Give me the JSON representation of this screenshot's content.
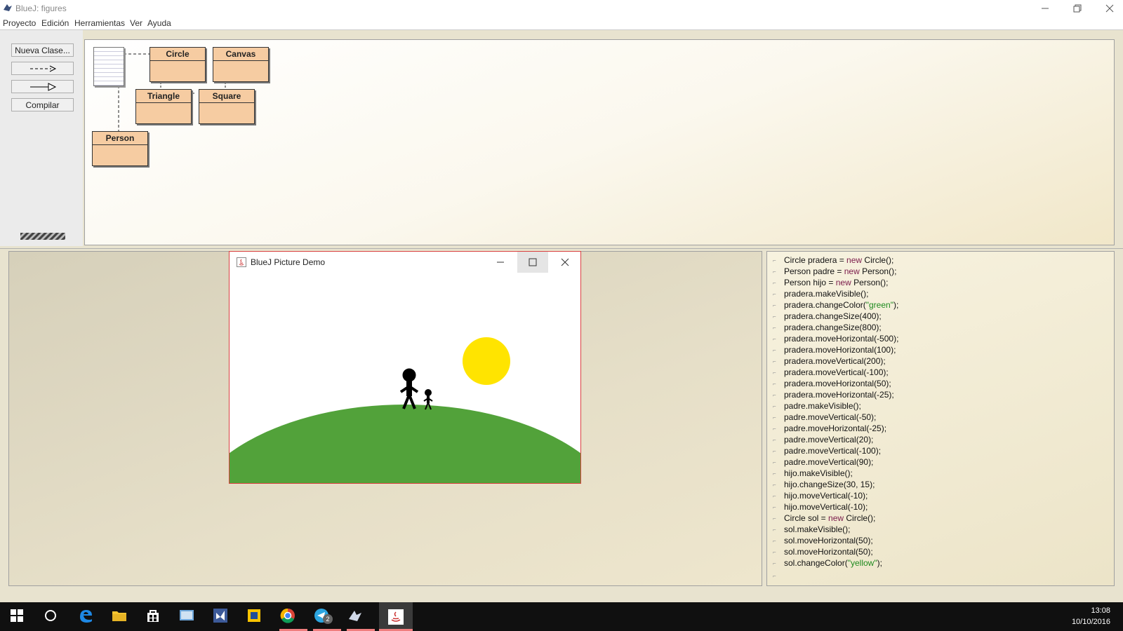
{
  "window": {
    "title": "BlueJ: figures"
  },
  "menu": [
    "Proyecto",
    "Edición",
    "Herramientas",
    "Ver",
    "Ayuda"
  ],
  "sidebar": {
    "new_class": "Nueva Clase...",
    "compile": "Compilar"
  },
  "classes": {
    "circle": "Circle",
    "canvas": "Canvas",
    "triangle": "Triangle",
    "square": "Square",
    "person": "Person"
  },
  "demo": {
    "title": "BlueJ Picture Demo"
  },
  "codepad": {
    "lines": [
      {
        "pre": "Circle pradera = ",
        "kw": "new",
        "post": " Circle();"
      },
      {
        "pre": "Person padre = ",
        "kw": "new",
        "post": " Person();"
      },
      {
        "pre": "Person hijo = ",
        "kw": "new",
        "post": " Person();"
      },
      {
        "pre": "pradera.makeVisible();"
      },
      {
        "pre": "pradera.changeColor(",
        "str": "\"green\"",
        "post": ");"
      },
      {
        "pre": "pradera.changeSize(400);"
      },
      {
        "pre": "pradera.changeSize(800);"
      },
      {
        "pre": "pradera.moveHorizontal(-500);"
      },
      {
        "pre": "pradera.moveHorizontal(100);"
      },
      {
        "pre": "pradera.moveVertical(200);"
      },
      {
        "pre": "pradera.moveVertical(-100);"
      },
      {
        "pre": "pradera.moveHorizontal(50);"
      },
      {
        "pre": "pradera.moveHorizontal(-25);"
      },
      {
        "pre": "padre.makeVisible();"
      },
      {
        "pre": "padre.moveVertical(-50);"
      },
      {
        "pre": "padre.moveHorizontal(-25);"
      },
      {
        "pre": "padre.moveVertical(20);"
      },
      {
        "pre": "padre.moveVertical(-100);"
      },
      {
        "pre": "padre.moveVertical(90);"
      },
      {
        "pre": "hijo.makeVisible();"
      },
      {
        "pre": "hijo.changeSize(30, 15);"
      },
      {
        "pre": "hijo.moveVertical(-10);"
      },
      {
        "pre": "hijo.moveVertical(-10);"
      },
      {
        "pre": "Circle sol = ",
        "kw": "new",
        "post": " Circle();"
      },
      {
        "pre": "sol.makeVisible();"
      },
      {
        "pre": "sol.moveHorizontal(50);"
      },
      {
        "pre": "sol.moveHorizontal(50);"
      },
      {
        "pre": "sol.changeColor(",
        "str": "\"yellow\"",
        "post": ");"
      }
    ]
  },
  "taskbar": {
    "time": "13:08",
    "date": "10/10/2016",
    "badge": "2"
  },
  "colors": {
    "class_fill": "#f6cca2",
    "grass": "#52a23a",
    "sun": "#ffe400",
    "keyword": "#7a1a4a",
    "string": "#1e8a1e"
  }
}
